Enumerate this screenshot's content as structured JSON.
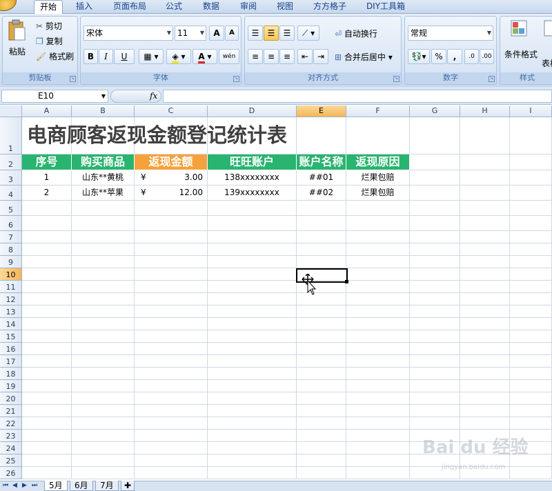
{
  "ribbon_tabs": [
    "开始",
    "插入",
    "页面布局",
    "公式",
    "数据",
    "审阅",
    "视图",
    "方方格子",
    "DIY工具箱"
  ],
  "clipboard": {
    "paste": "粘贴",
    "cut": "剪切",
    "copy": "复制",
    "format_painter": "格式刷",
    "group": "剪贴板"
  },
  "font": {
    "name": "宋体",
    "size": "11",
    "group": "字体",
    "bold": "B",
    "italic": "I",
    "underline": "U",
    "grow": "A",
    "shrink": "A"
  },
  "alignment": {
    "wrap": "自动换行",
    "merge": "合并后居中",
    "group": "对齐方式"
  },
  "number": {
    "format": "常规",
    "percent": "%",
    "comma": ",",
    "group": "数字"
  },
  "styles": {
    "conditional": "条件格式",
    "table": "表格",
    "group": "样式"
  },
  "formula_bar": {
    "name_box": "E10",
    "fx": "fx",
    "content": ""
  },
  "columns": [
    "A",
    "B",
    "C",
    "D",
    "E",
    "F",
    "G",
    "H",
    "I"
  ],
  "active_column": "E",
  "rows": [
    "1",
    "2",
    "3",
    "4",
    "5",
    "6",
    "7",
    "8",
    "9",
    "10",
    "11",
    "12",
    "13",
    "14",
    "15",
    "16",
    "17",
    "18",
    "19",
    "20",
    "21",
    "22",
    "23",
    "24",
    "25",
    "26"
  ],
  "active_row": "10",
  "sheet": {
    "title": "电商顾客返现金额登记统计表",
    "headers": [
      "序号",
      "购买商品",
      "返现金额",
      "旺旺账户",
      "账户名称",
      "返现原因"
    ],
    "records": [
      {
        "no": "1",
        "product": "山东**黄桃",
        "currency": "¥",
        "amount": "3.00",
        "wangwang": "138xxxxxxxx",
        "account": "##01",
        "reason": "烂果包赔"
      },
      {
        "no": "2",
        "product": "山东**苹果",
        "currency": "¥",
        "amount": "12.00",
        "wangwang": "139xxxxxxxx",
        "account": "##02",
        "reason": "烂果包赔"
      }
    ]
  },
  "sheet_tabs": [
    "5月",
    "6月",
    "7月"
  ],
  "active_sheet": "5月",
  "colors": {
    "header_green": "#29b46f",
    "header_orange": "#f6a23c",
    "active_header": "#f6b556"
  },
  "watermark": {
    "main": "Bai du 经验",
    "sub": "jingyan.baidu.com"
  }
}
